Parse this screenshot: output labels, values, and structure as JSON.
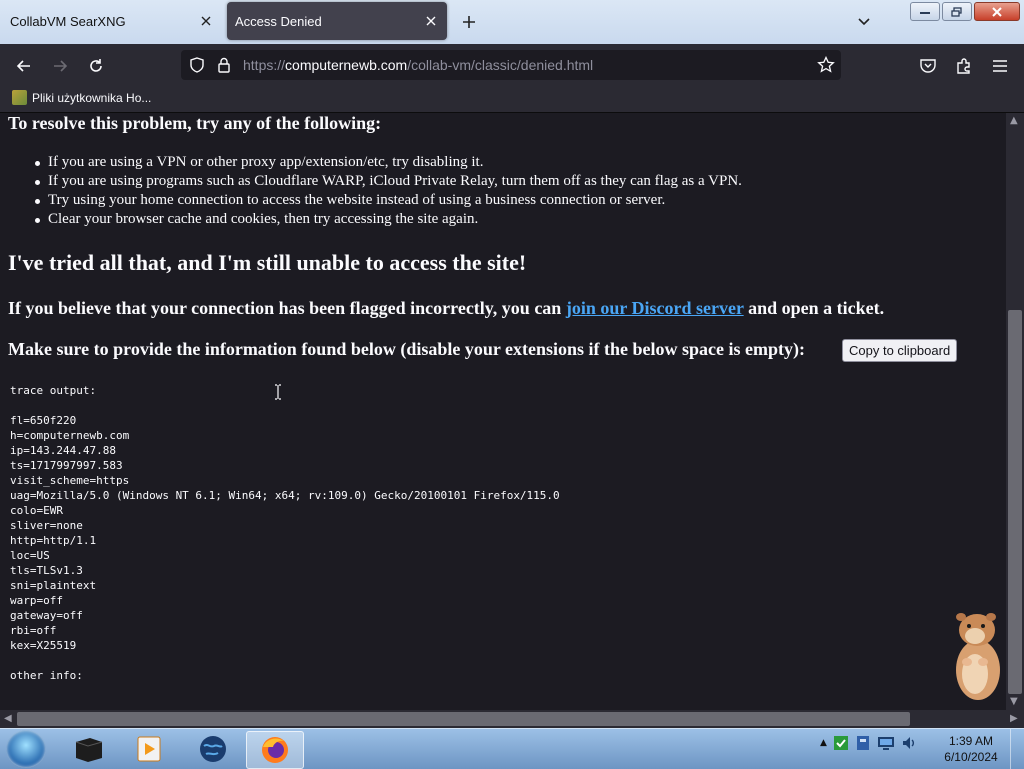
{
  "browser": {
    "tabs": [
      {
        "title": "CollabVM SearXNG",
        "active": false
      },
      {
        "title": "Access Denied",
        "active": true
      }
    ],
    "url_prefix": "https://",
    "url_host": "computernewb.com",
    "url_path": "/collab-vm/classic/denied.html",
    "bookmarks": [
      {
        "label": "Pliki użytkownika Ho..."
      }
    ]
  },
  "page": {
    "resolve_heading": "To resolve this problem, try any of the following:",
    "tips": [
      "If you are using a VPN or other proxy app/extension/etc, try disabling it.",
      "If you are using programs such as Cloudflare WARP, iCloud Private Relay, turn them off as they can flag as a VPN.",
      "Try using your home connection to access the website instead of using a business connection or server.",
      "Clear your browser cache and cookies, then try accessing the site again."
    ],
    "tried_heading": "I've tried all that, and I'm still unable to access the site!",
    "believe_before": "If you believe that your connection has been flagged incorrectly, you can ",
    "discord_link": "join our Discord server",
    "believe_after": " and open a ticket.",
    "provide_text": "Make sure to provide the information found below (disable your extensions if the below space is empty):",
    "copy_button": "Copy to clipboard",
    "trace": "trace output:\n\nfl=650f220\nh=computernewb.com\nip=143.244.47.88\nts=1717997997.583\nvisit_scheme=https\nuag=Mozilla/5.0 (Windows NT 6.1; Win64; x64; rv:109.0) Gecko/20100101 Firefox/115.0\ncolo=EWR\nsliver=none\nhttp=http/1.1\nloc=US\ntls=TLSv1.3\nsni=plaintext\nwarp=off\ngateway=off\nrbi=off\nkex=X25519\n\nother info:\n"
  },
  "taskbar": {
    "time": "1:39 AM",
    "date": "6/10/2024",
    "apps": [
      "terminal-app",
      "media-player-app",
      "globe-app",
      "firefox-app"
    ]
  },
  "colors": {
    "page_bg": "#1c1b22",
    "toolbar_bg": "#2b2a33",
    "link": "#4aa6f5",
    "active_tab": "#42414d"
  }
}
